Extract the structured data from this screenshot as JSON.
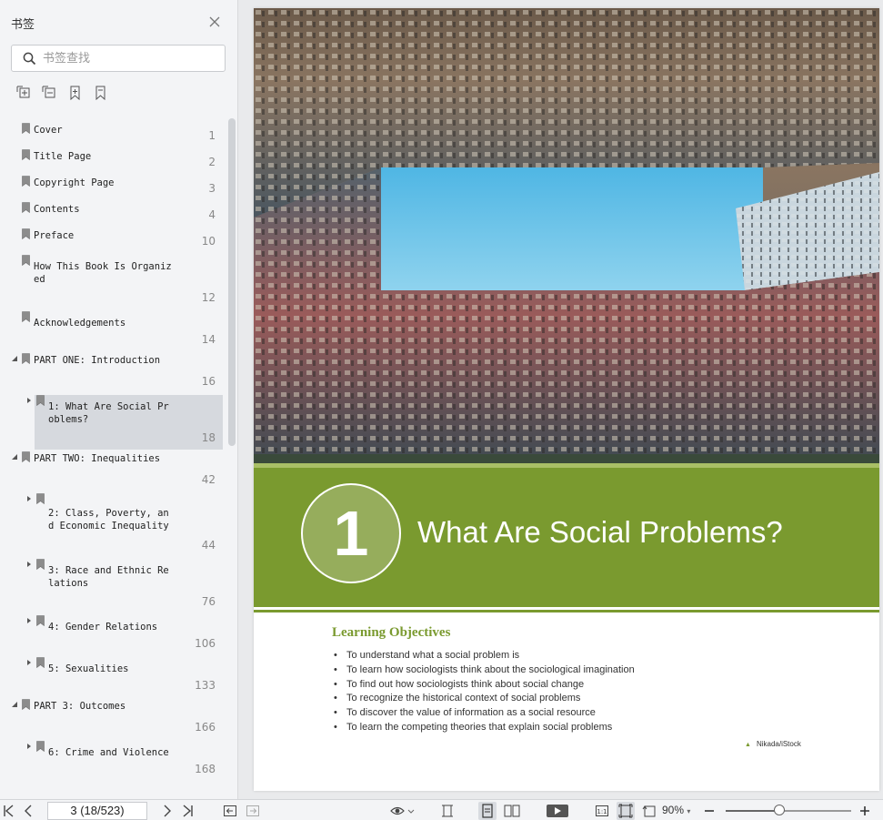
{
  "sidebar": {
    "title": "书签",
    "search_placeholder": "书签查找",
    "tools": [
      "expand-all-icon",
      "collapse-all-icon",
      "add-bookmark-icon",
      "bookmark-icon"
    ],
    "bookmarks": [
      {
        "label": "Cover",
        "page": "1",
        "level": 0,
        "arrow": "none"
      },
      {
        "label": "Title Page",
        "page": "2",
        "level": 0,
        "arrow": "none"
      },
      {
        "label": "Copyright Page",
        "page": "3",
        "level": 0,
        "arrow": "none"
      },
      {
        "label": "Contents",
        "page": "4",
        "level": 0,
        "arrow": "none"
      },
      {
        "label": "Preface",
        "page": "10",
        "level": 0,
        "arrow": "none"
      },
      {
        "label": "How This Book Is Organiz\ned",
        "page": "12",
        "level": 0,
        "arrow": "none"
      },
      {
        "label": "Acknowledgements",
        "page": "14",
        "level": 0,
        "arrow": "none"
      },
      {
        "label": "PART ONE: Introduction",
        "page": "16",
        "level": 0,
        "arrow": "down"
      },
      {
        "label": "1: What Are Social Pr\noblems?",
        "page": "18",
        "level": 1,
        "arrow": "right",
        "selected": true
      },
      {
        "label": "PART TWO: Inequalities",
        "page": "42",
        "level": 0,
        "arrow": "down"
      },
      {
        "label": "2: Class, Poverty, an\nd Economic Inequality",
        "page": "44",
        "level": 1,
        "arrow": "right"
      },
      {
        "label": "3: Race and Ethnic Re\nlations",
        "page": "76",
        "level": 1,
        "arrow": "right"
      },
      {
        "label": "4: Gender Relations",
        "page": "106",
        "level": 1,
        "arrow": "right"
      },
      {
        "label": "5: Sexualities",
        "page": "133",
        "level": 1,
        "arrow": "right"
      },
      {
        "label": "PART 3: Outcomes",
        "page": "166",
        "level": 0,
        "arrow": "down"
      },
      {
        "label": "6: Crime and Violence",
        "page": "168",
        "level": 1,
        "arrow": "right"
      }
    ]
  },
  "document": {
    "chapter_number": "1",
    "chapter_title": "What Are Social Problems?",
    "learning_objectives_title": "Learning Objectives",
    "objectives": [
      "To understand what a social problem is",
      "To learn how sociologists think about the sociological imagination",
      "To find out how sociologists think about social change",
      "To recognize the historical context of social problems",
      "To discover the value of information as a social resource",
      "To learn the competing theories that explain social problems"
    ],
    "photo_credit": "Nikada/iStock",
    "colors": {
      "accent_green": "#7a9a2f",
      "sky": "#5fbde0"
    }
  },
  "toolbar": {
    "page_indicator": "3 (18/523)",
    "zoom": "90%",
    "zoom_level": 0.43,
    "icons": [
      "first-page-icon",
      "prev-page-icon",
      "next-page-icon",
      "last-page-icon",
      "back-icon",
      "forward-icon",
      "eye-icon",
      "fit-width-icon",
      "single-page-icon",
      "two-page-icon",
      "play-icon",
      "actual-size-icon",
      "fit-page-icon",
      "rotate-icon",
      "zoom-out-icon",
      "zoom-in-icon"
    ]
  }
}
